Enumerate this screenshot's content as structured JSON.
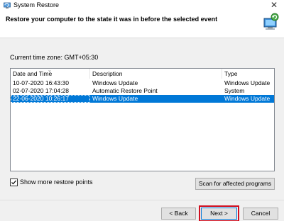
{
  "window": {
    "title": "System Restore",
    "close_symbol": "✕"
  },
  "header": {
    "heading": "Restore your computer to the state it was in before the selected event"
  },
  "timezone": {
    "label": "Current time zone: GMT+05:30"
  },
  "restore_points": {
    "columns": [
      "Date and Time",
      "Description",
      "Type"
    ],
    "rows": [
      {
        "date": "10-07-2020 16:43:30",
        "description": "Windows Update",
        "type": "Windows Update",
        "selected": false
      },
      {
        "date": "02-07-2020 17:04:28",
        "description": "Automatic Restore Point",
        "type": "System",
        "selected": false
      },
      {
        "date": "22-06-2020 10:26:17",
        "description": "Windows Update",
        "type": "Windows Update",
        "selected": true
      }
    ]
  },
  "options": {
    "show_more_label": "Show more restore points",
    "show_more_checked": true,
    "scan_button": "Scan for affected programs"
  },
  "footer": {
    "back_button": "< Back",
    "next_button": "Next >",
    "cancel_button": "Cancel"
  },
  "colors": {
    "selection": "#0078d7",
    "highlight_box": "#d00f1f"
  },
  "icons": {
    "app": "system-restore-icon",
    "header_logo": "computer-restore-icon",
    "close": "close-icon",
    "sort": "sort-arrow-icon",
    "check": "checkmark-icon"
  }
}
